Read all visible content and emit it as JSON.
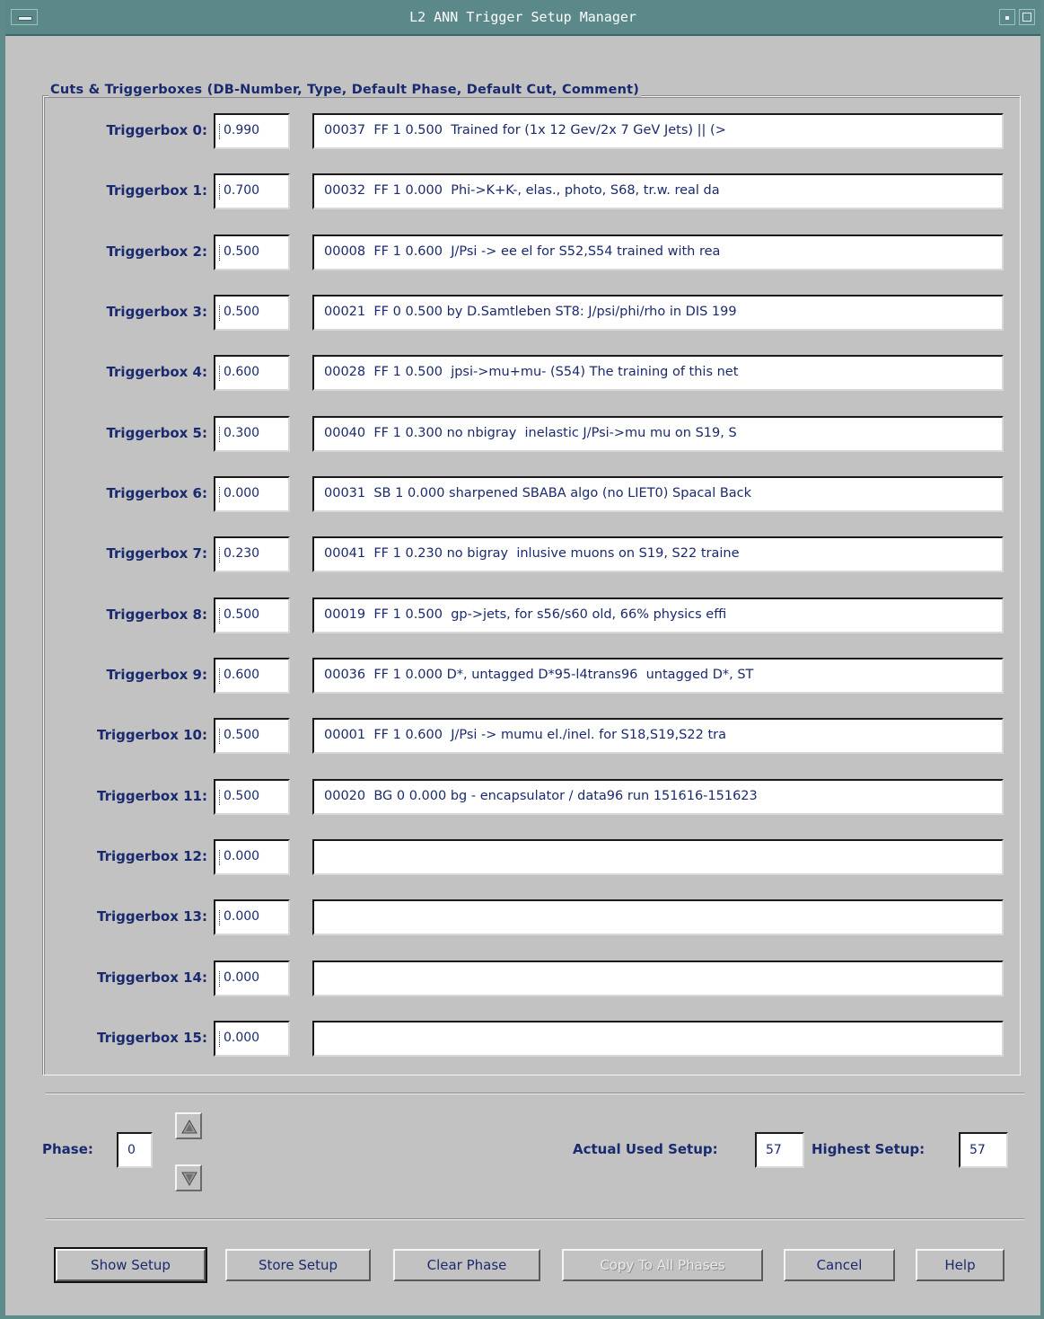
{
  "window": {
    "title": "L2 ANN Trigger Setup Manager"
  },
  "group": {
    "title": "Cuts & Triggerboxes (DB-Number, Type, Default Phase, Default Cut, Comment)"
  },
  "triggerboxes": [
    {
      "label": "Triggerbox 0:",
      "cut": "0.990",
      "comment": "00037  FF 1 0.500  Trained for (1x 12 Gev/2x 7 GeV Jets) || (>"
    },
    {
      "label": "Triggerbox 1:",
      "cut": "0.700",
      "comment": "00032  FF 1 0.000  Phi->K+K-, elas., photo, S68, tr.w. real da"
    },
    {
      "label": "Triggerbox 2:",
      "cut": "0.500",
      "comment": "00008  FF 1 0.600  J/Psi -> ee el for S52,S54 trained with rea"
    },
    {
      "label": "Triggerbox 3:",
      "cut": "0.500",
      "comment": "00021  FF 0 0.500 by D.Samtleben ST8: J/psi/phi/rho in DIS 199"
    },
    {
      "label": "Triggerbox 4:",
      "cut": "0.600",
      "comment": "00028  FF 1 0.500  jpsi->mu+mu- (S54) The training of this net"
    },
    {
      "label": "Triggerbox 5:",
      "cut": "0.300",
      "comment": "00040  FF 1 0.300 no nbigray  inelastic J/Psi->mu mu on S19, S"
    },
    {
      "label": "Triggerbox 6:",
      "cut": "0.000",
      "comment": "00031  SB 1 0.000 sharpened SBABA algo (no LIET0) Spacal Back"
    },
    {
      "label": "Triggerbox 7:",
      "cut": "0.230",
      "comment": "00041  FF 1 0.230 no bigray  inlusive muons on S19, S22 traine"
    },
    {
      "label": "Triggerbox 8:",
      "cut": "0.500",
      "comment": "00019  FF 1 0.500  gp->jets, for s56/s60 old, 66% physics effi"
    },
    {
      "label": "Triggerbox 9:",
      "cut": "0.600",
      "comment": "00036  FF 1 0.000 D*, untagged D*95-l4trans96  untagged D*, ST"
    },
    {
      "label": "Triggerbox 10:",
      "cut": "0.500",
      "comment": "00001  FF 1 0.600  J/Psi -> mumu el./inel. for S18,S19,S22 tra"
    },
    {
      "label": "Triggerbox 11:",
      "cut": "0.500",
      "comment": "00020  BG 0 0.000 bg - encapsulator / data96 run 151616-151623"
    },
    {
      "label": "Triggerbox 12:",
      "cut": "0.000",
      "comment": ""
    },
    {
      "label": "Triggerbox 13:",
      "cut": "0.000",
      "comment": ""
    },
    {
      "label": "Triggerbox 14:",
      "cut": "0.000",
      "comment": ""
    },
    {
      "label": "Triggerbox 15:",
      "cut": "0.000",
      "comment": ""
    }
  ],
  "phase": {
    "label": "Phase:",
    "value": "0",
    "up_icon": "triangle-up-icon",
    "down_icon": "triangle-down-icon"
  },
  "setup": {
    "actual_label": "Actual Used Setup:",
    "actual_value": "57",
    "highest_label": "Highest Setup:",
    "highest_value": "57"
  },
  "buttons": {
    "show_setup": "Show Setup",
    "store_setup": "Store Setup",
    "clear_phase": "Clear Phase",
    "copy_all": "Copy To All Phases",
    "cancel": "Cancel",
    "help": "Help"
  },
  "colors": {
    "titlebar": "#5b8989",
    "background": "#c2c2c2",
    "text": "#1a2a6e"
  }
}
